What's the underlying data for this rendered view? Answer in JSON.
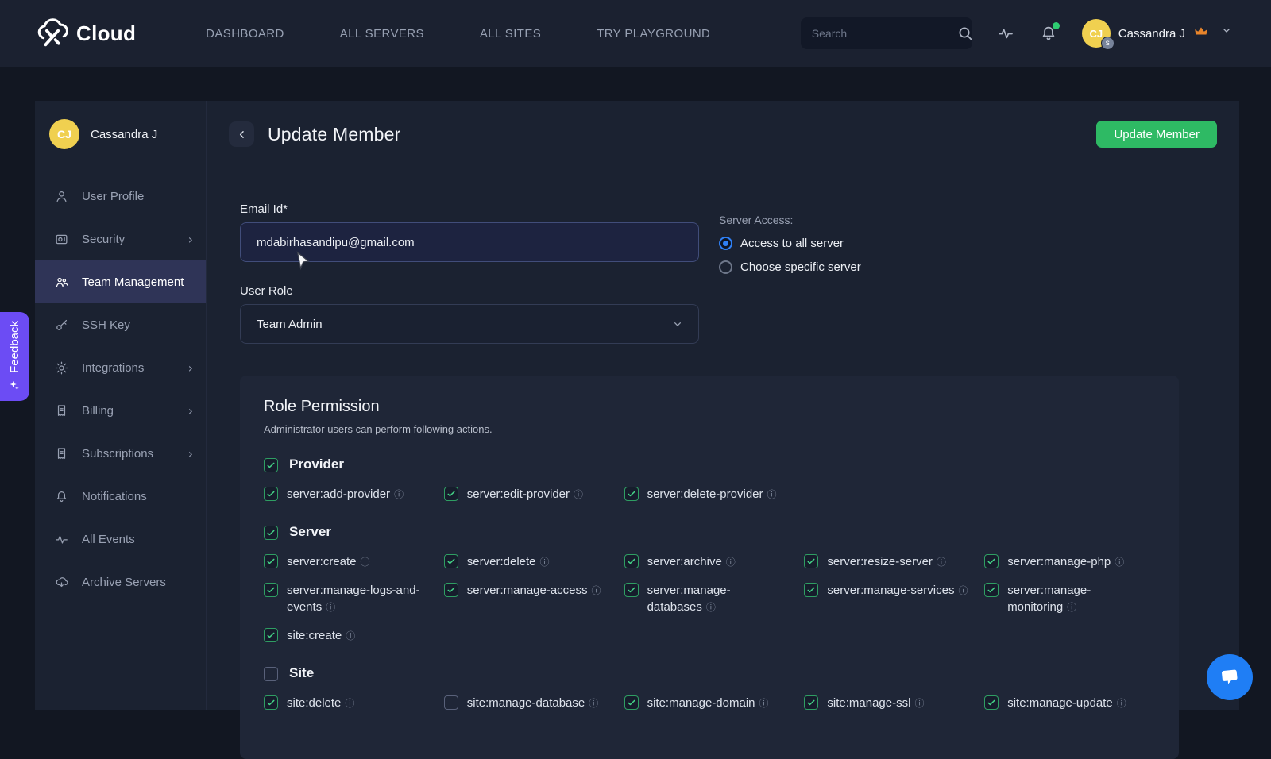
{
  "navbar": {
    "brand": "Cloud",
    "links": [
      "DASHBOARD",
      "ALL SERVERS",
      "ALL SITES",
      "TRY PLAYGROUND"
    ],
    "search_placeholder": "Search",
    "user": {
      "name": "Cassandra J",
      "initials": "CJ",
      "badge": "s"
    }
  },
  "sidebar": {
    "user": {
      "initials": "CJ",
      "name": "Cassandra J"
    },
    "items": [
      {
        "label": "User Profile",
        "icon": "user",
        "chevron": false,
        "active": false
      },
      {
        "label": "Security",
        "icon": "security",
        "chevron": true,
        "active": false
      },
      {
        "label": "Team Management",
        "icon": "team",
        "chevron": false,
        "active": true
      },
      {
        "label": "SSH Key",
        "icon": "key",
        "chevron": false,
        "active": false
      },
      {
        "label": "Integrations",
        "icon": "gear",
        "chevron": true,
        "active": false
      },
      {
        "label": "Billing",
        "icon": "receipt",
        "chevron": true,
        "active": false
      },
      {
        "label": "Subscriptions",
        "icon": "receipt",
        "chevron": true,
        "active": false
      },
      {
        "label": "Notifications",
        "icon": "bell",
        "chevron": false,
        "active": false
      },
      {
        "label": "All Events",
        "icon": "pulse",
        "chevron": false,
        "active": false
      },
      {
        "label": "Archive Servers",
        "icon": "archive",
        "chevron": false,
        "active": false
      }
    ]
  },
  "feedback_tab": {
    "label": "Feedback"
  },
  "main": {
    "title": "Update Member",
    "update_button": "Update Member",
    "form": {
      "email_label": "Email Id*",
      "email_value": "mdabirhasandipu@gmail.com",
      "user_role_label": "User Role",
      "user_role_value": "Team Admin",
      "server_access_label": "Server Access:",
      "radios": [
        {
          "label": "Access to all server",
          "selected": true
        },
        {
          "label": "Choose specific server",
          "selected": false
        }
      ]
    },
    "role_permission": {
      "title": "Role Permission",
      "subtitle": "Administrator users can perform following actions.",
      "groups": [
        {
          "label": "Provider",
          "checked": true,
          "items": [
            {
              "label": "server:add-provider",
              "checked": true
            },
            {
              "label": "server:edit-provider",
              "checked": true
            },
            {
              "label": "server:delete-provider",
              "checked": true
            }
          ]
        },
        {
          "label": "Server",
          "checked": true,
          "items": [
            {
              "label": "server:create",
              "checked": true
            },
            {
              "label": "server:delete",
              "checked": true
            },
            {
              "label": "server:archive",
              "checked": true
            },
            {
              "label": "server:resize-server",
              "checked": true
            },
            {
              "label": "server:manage-php",
              "checked": true
            },
            {
              "label": "server:manage-logs-and-events",
              "checked": true
            },
            {
              "label": "server:manage-access",
              "checked": true
            },
            {
              "label": "server:manage-databases",
              "checked": true
            },
            {
              "label": "server:manage-services",
              "checked": true
            },
            {
              "label": "server:manage-monitoring",
              "checked": true
            },
            {
              "label": "site:create",
              "checked": true
            }
          ]
        },
        {
          "label": "Site",
          "checked": false,
          "items": [
            {
              "label": "site:delete",
              "checked": true
            },
            {
              "label": "site:manage-database",
              "checked": false
            },
            {
              "label": "site:manage-domain",
              "checked": true
            },
            {
              "label": "site:manage-ssl",
              "checked": true
            },
            {
              "label": "site:manage-update",
              "checked": true
            }
          ]
        }
      ]
    }
  },
  "colors": {
    "accent_green": "#2eba64",
    "accent_blue": "#2f80f5",
    "accent_purple": "#6c4cf4",
    "avatar_yellow": "#f0d050",
    "crown_orange": "#e8852b",
    "chat_blue": "#1f7ef5",
    "checkbox_green": "#2f9e63"
  }
}
